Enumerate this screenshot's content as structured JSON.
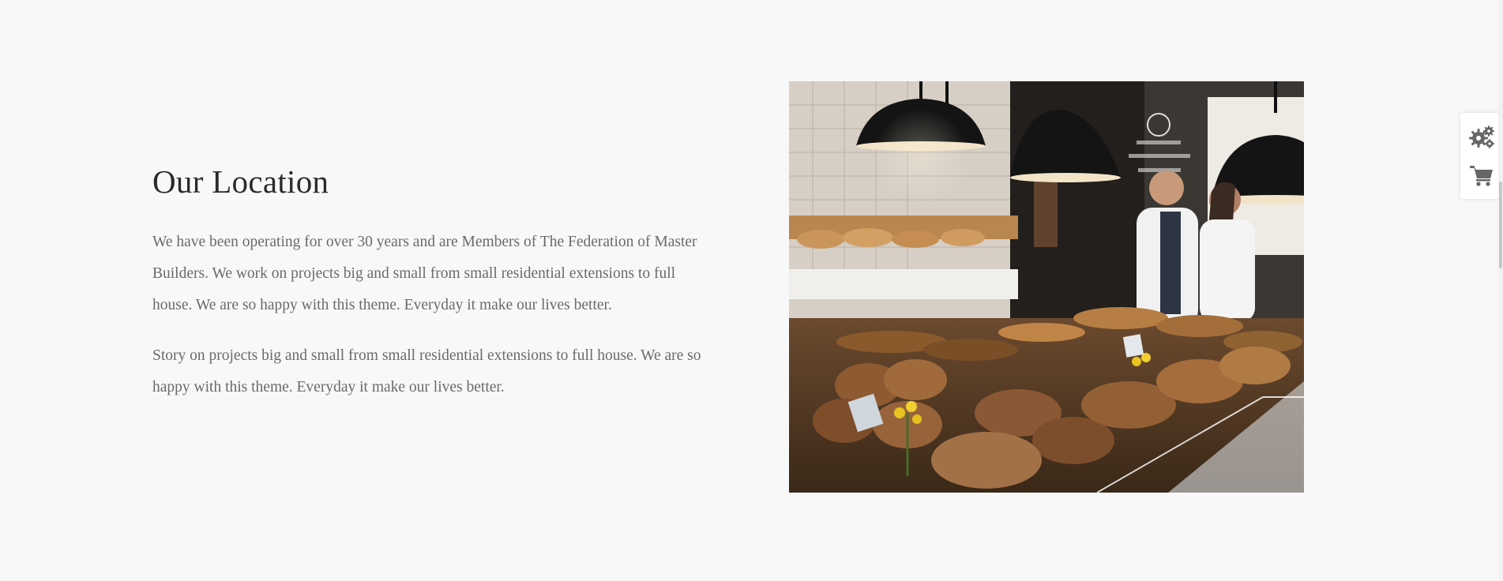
{
  "location": {
    "heading": "Our Location",
    "paragraph_1": "We have been operating for over 30 years and are Members of The Federation of Master Builders. We work on projects big and small from small residential extensions to full house. We are so happy with this theme. Everyday it make our lives better.",
    "paragraph_2": "Story on projects big and small from small residential extensions to full house. We are so happy with this theme. Everyday it make our lives better."
  },
  "photo": {
    "subject": "bakery counter with bread and pastries"
  },
  "side_tools": {
    "settings_icon": "gears-icon",
    "cart_icon": "cart-icon"
  },
  "colors": {
    "background": "#f8f8f8",
    "heading": "#2b2b2b",
    "body_text": "#6a6a6a",
    "icon": "#666666"
  }
}
